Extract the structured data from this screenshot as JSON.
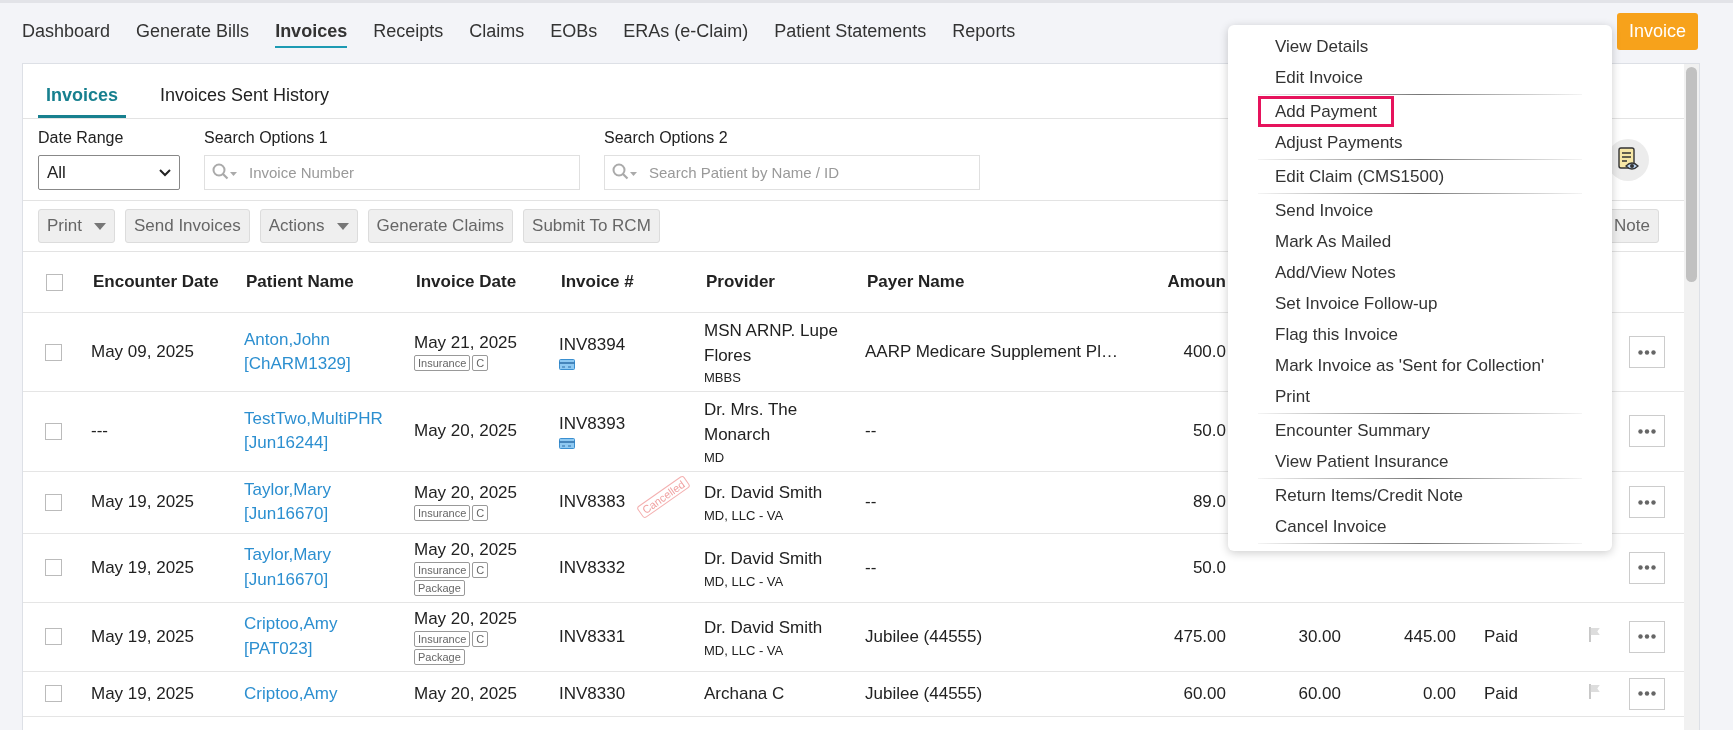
{
  "nav": {
    "tabs": [
      {
        "label": "Dashboard",
        "selected": false
      },
      {
        "label": "Generate Bills",
        "selected": false
      },
      {
        "label": "Invoices",
        "selected": true
      },
      {
        "label": "Receipts",
        "selected": false
      },
      {
        "label": "Claims",
        "selected": false
      },
      {
        "label": "EOBs",
        "selected": false
      },
      {
        "label": "ERAs (e-Claim)",
        "selected": false
      },
      {
        "label": "Patient Statements",
        "selected": false
      },
      {
        "label": "Reports",
        "selected": false
      }
    ],
    "new_button": "Invoice"
  },
  "subtabs": [
    {
      "label": "Invoices",
      "selected": true
    },
    {
      "label": "Invoices Sent History",
      "selected": false
    }
  ],
  "filters": {
    "date_range": {
      "label": "Date Range",
      "value": "All"
    },
    "search_1": {
      "label": "Search Options 1",
      "placeholder": "Invoice Number"
    },
    "search_2": {
      "label": "Search Options 2",
      "placeholder": "Search Patient by Name / ID"
    }
  },
  "toolbar": [
    {
      "label": "Print",
      "kind": "dropdown"
    },
    {
      "label": "Send Invoices",
      "kind": "button"
    },
    {
      "label": "Actions",
      "kind": "dropdown"
    },
    {
      "label": "Generate Claims",
      "kind": "button"
    },
    {
      "label": "Submit To RCM",
      "kind": "button"
    }
  ],
  "toolbar_right": "Note",
  "table": {
    "all_checked": false,
    "columns": [
      "Encounter Date",
      "Patient Name",
      "Invoice Date",
      "Invoice #",
      "Provider",
      "Payer Name",
      "Amoun"
    ],
    "rows": [
      {
        "checked": false,
        "encounter_date": "May 09, 2025",
        "patient": "Anton,John [ChARM1329]",
        "invoice_date": "May 21, 2025",
        "badge_rows": [
          [
            "Insurance",
            "C"
          ]
        ],
        "invoice_no": "INV8394",
        "card": true,
        "provider": "MSN ARNP. Lupe Flores",
        "credential": "MBBS",
        "payer": "AARP Medicare Supplement Pl…",
        "amount": "400.0"
      },
      {
        "checked": false,
        "encounter_date": "---",
        "patient": "TestTwo,MultiPHR [Jun16244]",
        "invoice_date": "May 20, 2025",
        "invoice_no": "INV8393",
        "card": true,
        "provider": "Dr. Mrs. The Monarch",
        "credential": "MD",
        "payer": "--",
        "amount": "50.0"
      },
      {
        "checked": false,
        "encounter_date": "May 19, 2025",
        "patient": "Taylor,Mary [Jun16670]",
        "invoice_date": "May 20, 2025",
        "badge_rows": [
          [
            "Insurance",
            "C"
          ]
        ],
        "invoice_no": "INV8383",
        "card": false,
        "stamp": "Cancelled",
        "provider": "Dr. David Smith",
        "credential": "MD, LLC - VA",
        "payer": "--",
        "amount": "89.0"
      },
      {
        "checked": false,
        "encounter_date": "May 19, 2025",
        "patient": "Taylor,Mary [Jun16670]",
        "invoice_date": "May 20, 2025",
        "badge_rows": [
          [
            "Insurance",
            "C"
          ],
          [
            "Package"
          ]
        ],
        "invoice_no": "INV8332",
        "card": false,
        "provider": "Dr. David Smith",
        "credential": "MD, LLC - VA",
        "payer": "--",
        "amount": "50.0"
      },
      {
        "checked": false,
        "encounter_date": "May 19, 2025",
        "patient": "Criptoo,Amy [PAT023]",
        "invoice_date": "May 20, 2025",
        "badge_rows": [
          [
            "Insurance",
            "C"
          ],
          [
            "Package"
          ]
        ],
        "invoice_no": "INV8331",
        "card": false,
        "provider": "Dr. David Smith",
        "credential": "MD, LLC - VA",
        "payer": "Jubilee (44555)",
        "amount": "475.00",
        "paid": "30.00",
        "balance": "445.00",
        "status": "Paid"
      },
      {
        "checked": false,
        "encounter_date": "May 19, 2025",
        "patient": "Criptoo,Amy",
        "invoice_date": "May 20, 2025",
        "invoice_no": "INV8330",
        "card": false,
        "provider": "Archana C",
        "payer": "Jubilee (44555)",
        "amount": "60.00",
        "paid": "60.00",
        "balance": "0.00",
        "status": "Paid"
      }
    ]
  },
  "menu": {
    "groups": [
      {
        "items": [
          {
            "label": "View Details",
            "highlighted": false
          },
          {
            "label": "Edit Invoice",
            "highlighted": false
          }
        ]
      },
      {
        "items": [
          {
            "label": "Add Payment",
            "highlighted": true
          },
          {
            "label": "Adjust Payments",
            "highlighted": false
          }
        ]
      },
      {
        "items": [
          {
            "label": "Edit Claim (CMS1500)",
            "highlighted": false
          }
        ]
      },
      {
        "items": [
          {
            "label": "Send Invoice",
            "highlighted": false
          },
          {
            "label": "Mark As Mailed",
            "highlighted": false
          },
          {
            "label": "Add/View Notes",
            "highlighted": false
          },
          {
            "label": "Set Invoice Follow-up",
            "highlighted": false
          },
          {
            "label": "Flag this Invoice",
            "highlighted": false
          },
          {
            "label": "Mark Invoice as 'Sent for Collection'",
            "highlighted": false
          },
          {
            "label": "Print",
            "highlighted": false
          }
        ]
      },
      {
        "items": [
          {
            "label": "Encounter Summary",
            "highlighted": false
          },
          {
            "label": "View Patient Insurance",
            "highlighted": false
          }
        ]
      },
      {
        "items": [
          {
            "label": "Return Items/Credit Note",
            "highlighted": false
          },
          {
            "label": "Cancel Invoice",
            "highlighted": false
          }
        ]
      }
    ]
  }
}
